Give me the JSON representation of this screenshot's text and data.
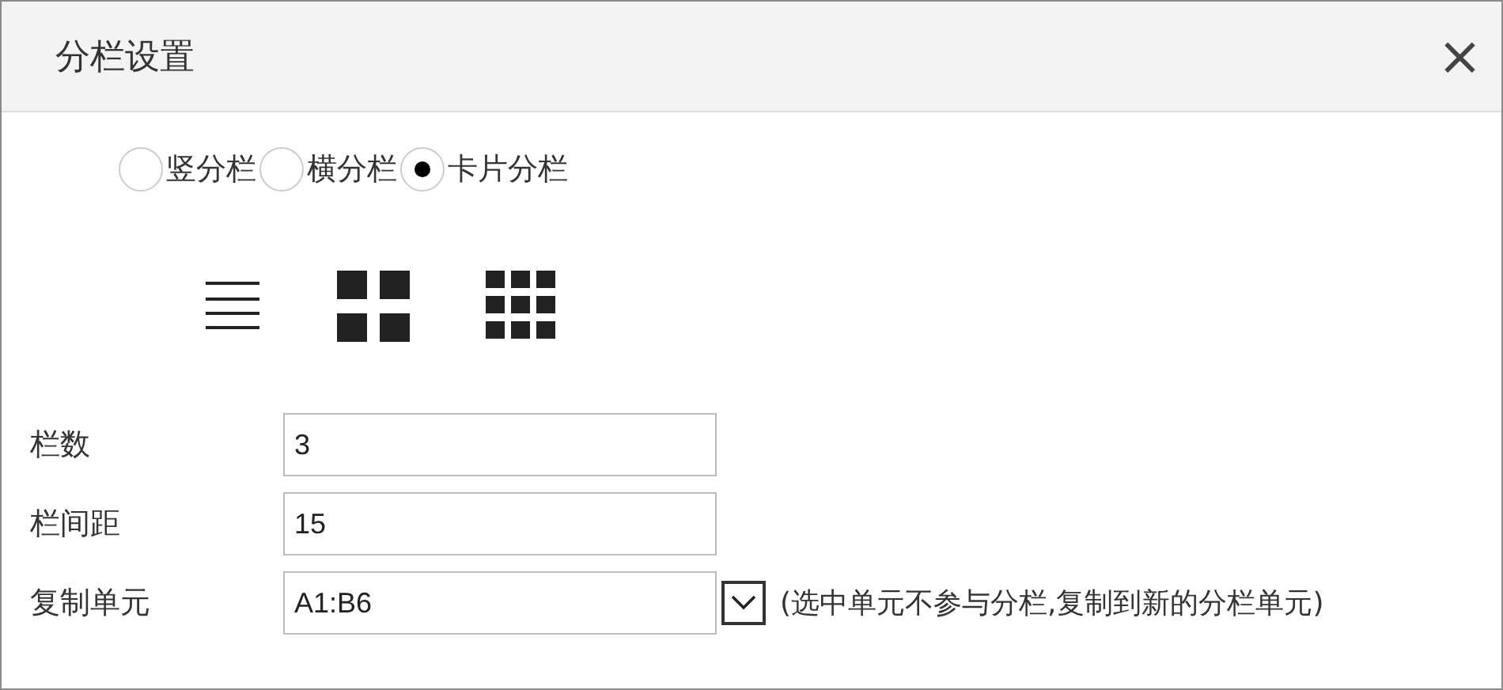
{
  "window": {
    "title": "分栏设置",
    "close": "×"
  },
  "modes": [
    {
      "label": "竖分栏",
      "selected": false
    },
    {
      "label": "横分栏",
      "selected": false
    },
    {
      "label": "卡片分栏",
      "selected": true
    }
  ],
  "layouts": [
    {
      "kind": "list"
    },
    {
      "kind": "grid2"
    },
    {
      "kind": "grid3"
    }
  ],
  "fields": [
    {
      "label": "栏数",
      "value": "3"
    },
    {
      "label": "栏间距",
      "value": "15"
    },
    {
      "label": "复制单元",
      "value": "A1:B6",
      "dropdown": true,
      "note": "(选中单元不参与分栏,复制到新的分栏单元)"
    }
  ]
}
